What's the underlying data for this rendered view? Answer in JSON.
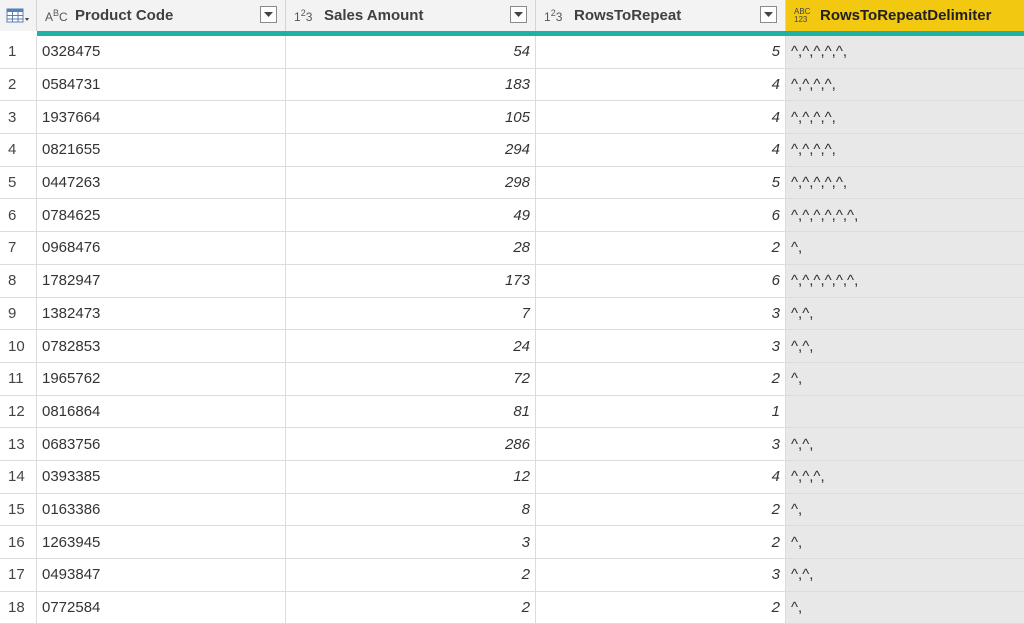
{
  "columns": [
    {
      "name": "Product Code",
      "type_icon": "text-type-icon",
      "type_label": "ABC"
    },
    {
      "name": "Sales Amount",
      "type_icon": "whole-number-type-icon",
      "type_label": "123"
    },
    {
      "name": "RowsToRepeat",
      "type_icon": "whole-number-type-icon",
      "type_label": "123"
    },
    {
      "name": "RowsToRepeatDelimiter",
      "type_icon": "any-type-icon",
      "type_label": "ABC 123"
    }
  ],
  "colors": {
    "quality_bar": "#1eb2a6",
    "selected_header": "#f2c811",
    "selected_column_bg": "#e8e8e8"
  },
  "rows": [
    {
      "idx": "1",
      "code": "0328475",
      "sales": "54",
      "rep": "5",
      "delim": "^,^,^,^,^,"
    },
    {
      "idx": "2",
      "code": "0584731",
      "sales": "183",
      "rep": "4",
      "delim": "^,^,^,^,"
    },
    {
      "idx": "3",
      "code": "1937664",
      "sales": "105",
      "rep": "4",
      "delim": "^,^,^,^,"
    },
    {
      "idx": "4",
      "code": "0821655",
      "sales": "294",
      "rep": "4",
      "delim": "^,^,^,^,"
    },
    {
      "idx": "5",
      "code": "0447263",
      "sales": "298",
      "rep": "5",
      "delim": "^,^,^,^,^,"
    },
    {
      "idx": "6",
      "code": "0784625",
      "sales": "49",
      "rep": "6",
      "delim": "^,^,^,^,^,^,"
    },
    {
      "idx": "7",
      "code": "0968476",
      "sales": "28",
      "rep": "2",
      "delim": "^,"
    },
    {
      "idx": "8",
      "code": "1782947",
      "sales": "173",
      "rep": "6",
      "delim": "^,^,^,^,^,^,"
    },
    {
      "idx": "9",
      "code": "1382473",
      "sales": "7",
      "rep": "3",
      "delim": "^,^,"
    },
    {
      "idx": "10",
      "code": "0782853",
      "sales": "24",
      "rep": "3",
      "delim": "^,^,"
    },
    {
      "idx": "11",
      "code": "1965762",
      "sales": "72",
      "rep": "2",
      "delim": "^,"
    },
    {
      "idx": "12",
      "code": "0816864",
      "sales": "81",
      "rep": "1",
      "delim": ""
    },
    {
      "idx": "13",
      "code": "0683756",
      "sales": "286",
      "rep": "3",
      "delim": "^,^,"
    },
    {
      "idx": "14",
      "code": "0393385",
      "sales": "12",
      "rep": "4",
      "delim": "^,^,^,"
    },
    {
      "idx": "15",
      "code": "0163386",
      "sales": "8",
      "rep": "2",
      "delim": "^,"
    },
    {
      "idx": "16",
      "code": "1263945",
      "sales": "3",
      "rep": "2",
      "delim": "^,"
    },
    {
      "idx": "17",
      "code": "0493847",
      "sales": "2",
      "rep": "3",
      "delim": "^,^,"
    },
    {
      "idx": "18",
      "code": "0772584",
      "sales": "2",
      "rep": "2",
      "delim": "^,"
    }
  ]
}
